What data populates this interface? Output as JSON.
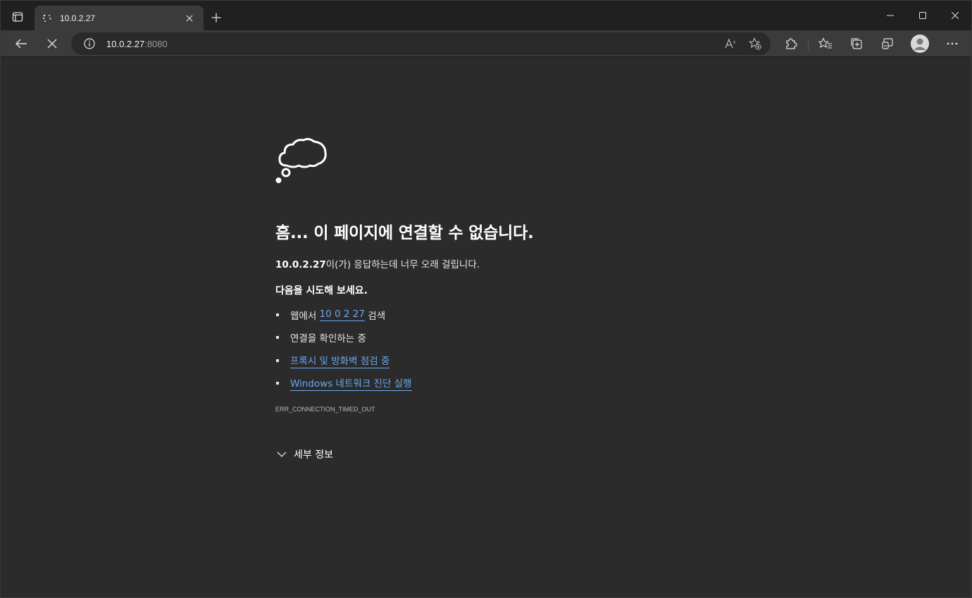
{
  "tab": {
    "title": "10.0.2.27",
    "close_icon": "close-icon"
  },
  "window_controls": [
    "minimize-icon",
    "maximize-icon",
    "close-icon"
  ],
  "address": {
    "host": "10.0.2.27",
    "port": ":8080"
  },
  "error": {
    "heading": "흠... 이 페이지에 연결할 수 없습니다.",
    "desc_host": "10.0.2.27",
    "desc_text": "이(가) 응답하는데 너무 오래 걸립니다.",
    "try_title": "다음을 시도해 보세요.",
    "suggestions": {
      "search_prefix": "웹에서 ",
      "search_link": "10 0 2 27",
      "search_suffix": " 검색",
      "check_connection": "연결을 확인하는 중",
      "check_proxy": "프록시 및 방화벽 점검 중",
      "run_diagnostics": "Windows 네트워크 진단 실행"
    },
    "code": "ERR_CONNECTION_TIMED_OUT",
    "details_label": "세부 정보"
  },
  "colors": {
    "link": "#6aa8f0",
    "background": "#2b2b2b",
    "toolbar": "#3b3b3b"
  }
}
